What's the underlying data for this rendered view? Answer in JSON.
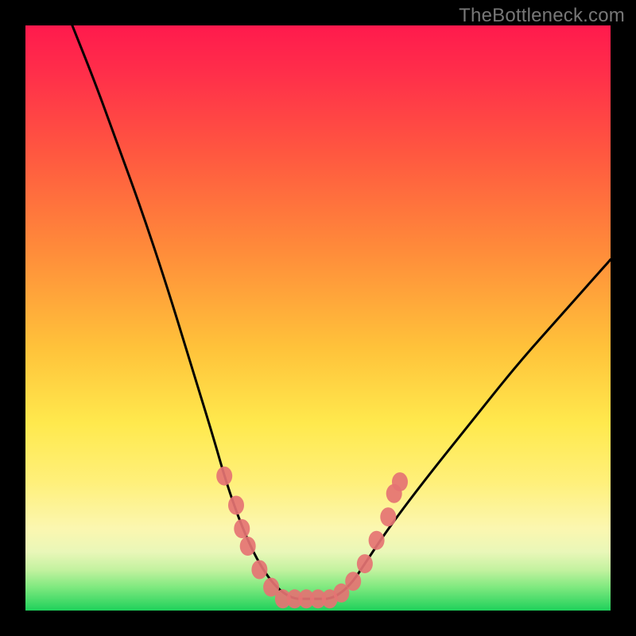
{
  "attribution": "TheBottleneck.com",
  "chart_data": {
    "type": "line",
    "title": "",
    "xlabel": "",
    "ylabel": "",
    "xlim": [
      0,
      100
    ],
    "ylim": [
      0,
      100
    ],
    "series": [
      {
        "name": "bottleneck-curve",
        "x": [
          8,
          12,
          16,
          20,
          24,
          28,
          32,
          34,
          36,
          38,
          40,
          42,
          44,
          46,
          48,
          50,
          52,
          54,
          56,
          58,
          62,
          68,
          76,
          84,
          92,
          100
        ],
        "y": [
          100,
          90,
          79,
          68,
          56,
          43,
          30,
          23,
          17,
          12,
          8,
          5,
          3,
          2,
          2,
          2,
          2,
          3,
          5,
          8,
          14,
          22,
          32,
          42,
          51,
          60
        ]
      }
    ],
    "markers": {
      "name": "highlighted-points",
      "color": "#e57373",
      "points": [
        {
          "x": 34,
          "y": 23
        },
        {
          "x": 36,
          "y": 18
        },
        {
          "x": 37,
          "y": 14
        },
        {
          "x": 38,
          "y": 11
        },
        {
          "x": 40,
          "y": 7
        },
        {
          "x": 42,
          "y": 4
        },
        {
          "x": 44,
          "y": 2
        },
        {
          "x": 46,
          "y": 2
        },
        {
          "x": 48,
          "y": 2
        },
        {
          "x": 50,
          "y": 2
        },
        {
          "x": 52,
          "y": 2
        },
        {
          "x": 54,
          "y": 3
        },
        {
          "x": 56,
          "y": 5
        },
        {
          "x": 58,
          "y": 8
        },
        {
          "x": 60,
          "y": 12
        },
        {
          "x": 62,
          "y": 16
        },
        {
          "x": 63,
          "y": 20
        },
        {
          "x": 64,
          "y": 22
        }
      ]
    }
  },
  "colors": {
    "curve": "#000000",
    "marker": "#e57373",
    "frame": "#000000"
  }
}
